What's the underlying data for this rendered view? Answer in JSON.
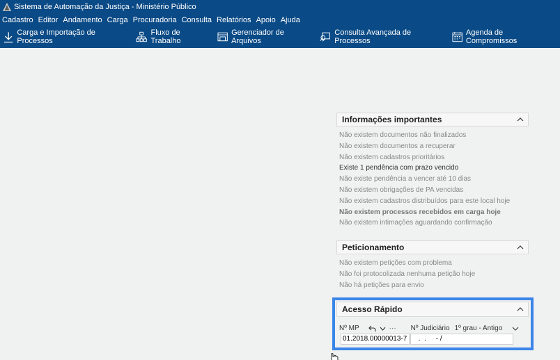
{
  "window": {
    "title": "Sistema de Automação da Justiça - Ministério Público"
  },
  "menu": [
    "Cadastro",
    "Editor",
    "Andamento",
    "Carga",
    "Procuradoria",
    "Consulta",
    "Relatórios",
    "Apoio",
    "Ajuda"
  ],
  "toolbar": [
    {
      "label": "Carga e Importação de Processos",
      "icon": "download-icon"
    },
    {
      "label": "Fluxo de Trabalho",
      "icon": "workflow-icon"
    },
    {
      "label": "Gerenciador de Arquivos",
      "icon": "file-manager-icon"
    },
    {
      "label": "Consulta Avançada de Processos",
      "icon": "search-chat-icon"
    },
    {
      "label": "Agenda de Compromissos",
      "icon": "calendar-icon"
    }
  ],
  "info": {
    "title": "Informações importantes",
    "items": [
      "Não existem documentos não finalizados",
      "Não existem documentos a recuperar",
      "Não existem cadastros prioritários",
      "Existe 1 pendência com prazo vencido",
      "Não existe pendência a vencer até 10 dias",
      "Não existem obrigações de PA vencidas",
      "Não existem cadastros distribuídos para este local hoje",
      "Não existem processos recebidos em carga hoje",
      "Não existem intimações aguardando confirmação"
    ]
  },
  "peticionamento": {
    "title": "Peticionamento",
    "items": [
      "Não existem petições com problema",
      "Não foi protocolizada nenhuma petição hoje",
      "Não há petições para envio"
    ]
  },
  "acesso": {
    "title": "Acesso Rápido",
    "mp_label": "Nº MP",
    "ellipsis": "···",
    "jud_label": "Nº Judiciário",
    "grau": "1º grau - Antigo",
    "mp_value": "01.2018.00000013-7",
    "jud_value": " .  .     - /"
  },
  "colors": {
    "header": "#0a4a86",
    "highlight": "#3b86e8"
  }
}
